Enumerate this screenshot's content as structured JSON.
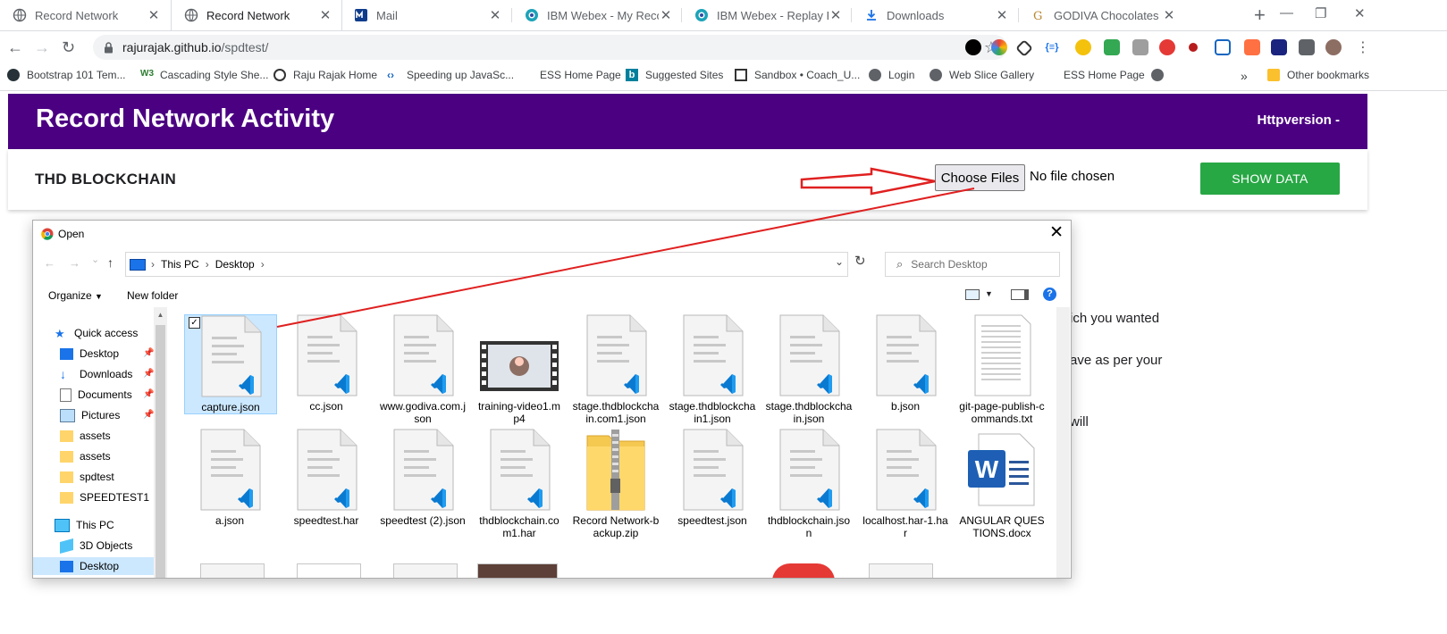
{
  "browser": {
    "tabs": [
      {
        "title": "Record Network",
        "active": false
      },
      {
        "title": "Record Network",
        "active": true
      },
      {
        "title": "Mail",
        "active": false
      },
      {
        "title": "IBM Webex - My Record",
        "active": false
      },
      {
        "title": "IBM Webex - Replay Rec",
        "active": false
      },
      {
        "title": "Downloads",
        "active": false
      },
      {
        "title": "GODIVA Chocolates | Go",
        "active": false
      }
    ],
    "address": {
      "host": "rajurajak.github.io",
      "path": "/spdtest/"
    },
    "bookmarks": [
      "Bootstrap 101 Tem...",
      "Cascading Style She...",
      "Raju Rajak Home",
      "Speeding up JavaSc...",
      "ESS Home Page",
      "Suggested Sites",
      "Sandbox • Coach_U...",
      "Login",
      "Web Slice Gallery",
      "ESS Home Page"
    ],
    "other_bookmarks": "Other bookmarks",
    "overflow": "»"
  },
  "page": {
    "title": "Record Network Activity",
    "http_version": "Httpversion -",
    "project": "THD BLOCKCHAIN",
    "choose_files": "Choose Files",
    "no_file": "No file chosen",
    "show_data": "SHOW DATA",
    "partial_text": [
      "ich you wanted",
      "ave as per your",
      "will"
    ]
  },
  "dialog": {
    "title": "Open",
    "breadcrumb": [
      "This PC",
      "Desktop"
    ],
    "search_placeholder": "Search Desktop",
    "organize": "Organize",
    "new_folder": "New folder",
    "nav": [
      {
        "label": "Quick access",
        "icon": "star-icon",
        "pinned": false
      },
      {
        "label": "Desktop",
        "icon": "desktop-icon",
        "pinned": true
      },
      {
        "label": "Downloads",
        "icon": "download-icon",
        "pinned": true
      },
      {
        "label": "Documents",
        "icon": "documents-icon",
        "pinned": true
      },
      {
        "label": "Pictures",
        "icon": "pictures-icon",
        "pinned": true
      },
      {
        "label": "assets",
        "icon": "folder-icon",
        "pinned": false
      },
      {
        "label": "assets",
        "icon": "folder-icon",
        "pinned": false
      },
      {
        "label": "spdtest",
        "icon": "folder-icon",
        "pinned": false
      },
      {
        "label": "SPEEDTEST1",
        "icon": "folder-icon",
        "pinned": false
      },
      {
        "label": "This PC",
        "icon": "pc-icon",
        "pinned": false
      },
      {
        "label": "3D Objects",
        "icon": "cube-icon",
        "pinned": false
      },
      {
        "label": "Desktop",
        "icon": "desktop-icon",
        "pinned": false,
        "selected": true
      }
    ],
    "files_row1": [
      {
        "name": "capture.json",
        "type": "vscode",
        "selected": true
      },
      {
        "name": "cc.json",
        "type": "vscode"
      },
      {
        "name": "www.godiva.com.json",
        "type": "vscode"
      },
      {
        "name": "training-video1.mp4",
        "type": "video"
      },
      {
        "name": "stage.thdblockchain.com1.json",
        "type": "vscode"
      },
      {
        "name": "stage.thdblockchain1.json",
        "type": "vscode"
      },
      {
        "name": "stage.thdblockchain.json",
        "type": "vscode"
      },
      {
        "name": "b.json",
        "type": "vscode"
      },
      {
        "name": "git-page-publish-commands.txt",
        "type": "text"
      }
    ],
    "files_row2": [
      {
        "name": "a.json",
        "type": "vscode"
      },
      {
        "name": "speedtest.har",
        "type": "vscode"
      },
      {
        "name": "speedtest (2).json",
        "type": "vscode"
      },
      {
        "name": "thdblockchain.com1.har",
        "type": "vscode"
      },
      {
        "name": "Record Network-backup.zip",
        "type": "zip"
      },
      {
        "name": "speedtest.json",
        "type": "vscode"
      },
      {
        "name": "thdblockchain.json",
        "type": "vscode"
      },
      {
        "name": "localhost.har-1.har",
        "type": "vscode"
      },
      {
        "name": "ANGULAR QUESTIONS.docx",
        "type": "word"
      }
    ]
  },
  "colors": {
    "header": "#4b0082",
    "button": "#28a745",
    "arrow": "#e02020",
    "selection": "#cce8ff"
  }
}
